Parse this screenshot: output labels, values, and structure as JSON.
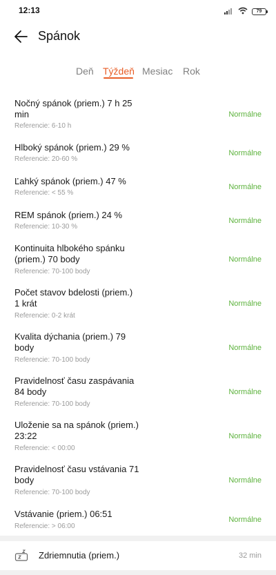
{
  "status_bar": {
    "time": "12:13",
    "battery": "79",
    "icons": [
      "signal-icon",
      "wifi-icon",
      "battery-icon"
    ]
  },
  "header": {
    "back_icon": "arrow-left-icon",
    "title": "Spánok"
  },
  "tabs": [
    {
      "label": "Deň",
      "active": false
    },
    {
      "label": "Týždeň",
      "active": true
    },
    {
      "label": "Mesiac",
      "active": false
    },
    {
      "label": "Rok",
      "active": false
    }
  ],
  "colors": {
    "accent": "#e85d26",
    "status_normal": "#5cb23c",
    "reference_text": "#9a9a9a",
    "divider": "#f1f1f1"
  },
  "metrics": [
    {
      "title": "Nočný spánok (priem.)  7 h 25\nmin",
      "reference": "Referencie: 6-10 h",
      "status": "Normálne"
    },
    {
      "title": "Hlboký spánok (priem.)  29 %",
      "reference": "Referencie: 20-60 %",
      "status": "Normálne"
    },
    {
      "title": "Ľahký spánok (priem.)  47 %",
      "reference": "Referencie: < 55 %",
      "status": "Normálne"
    },
    {
      "title": "REM spánok (priem.)  24 %",
      "reference": "Referencie: 10-30 %",
      "status": "Normálne"
    },
    {
      "title": "Kontinuita hlbokého spánku\n(priem.)  70 body",
      "reference": "Referencie: 70-100 body",
      "status": "Normálne"
    },
    {
      "title": "Počet stavov bdelosti (priem.)\n1 krát",
      "reference": "Referencie: 0-2 krát",
      "status": "Normálne"
    },
    {
      "title": "Kvalita dýchania (priem.)  79\nbody",
      "reference": "Referencie: 70-100 body",
      "status": "Normálne"
    },
    {
      "title": "Pravidelnosť času zaspávania\n84 body",
      "reference": "Referencie: 70-100 body",
      "status": "Normálne"
    },
    {
      "title": "Uloženie sa na spánok (priem.)\n23:22",
      "reference": "Referencie: < 00:00",
      "status": "Normálne"
    },
    {
      "title": "Pravidelnosť času vstávania  71\nbody",
      "reference": "Referencie: 70-100 body",
      "status": "Normálne"
    },
    {
      "title": "Vstávanie (priem.)  06:51",
      "reference": "Referencie: > 06:00",
      "status": "Normálne"
    }
  ],
  "nap": {
    "icon": "nap-zz-icon",
    "label": "Zdriemnutia (priem.)",
    "value": "32 min"
  }
}
